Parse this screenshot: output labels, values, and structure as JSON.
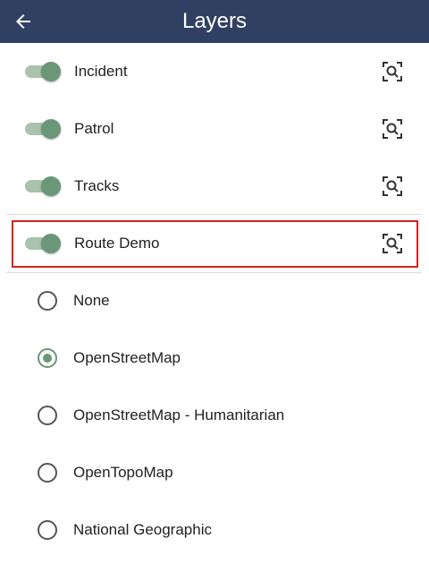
{
  "header": {
    "title": "Layers",
    "back_icon": "arrow-left-icon",
    "background": "#2f4063"
  },
  "layers": [
    {
      "label": "Incident",
      "enabled": true,
      "action_icon": "zoom-to-layer-icon"
    },
    {
      "label": "Patrol",
      "enabled": true,
      "action_icon": "zoom-to-layer-icon"
    },
    {
      "label": "Tracks",
      "enabled": true,
      "action_icon": "zoom-to-layer-icon"
    },
    {
      "label": "Route Demo",
      "enabled": true,
      "action_icon": "zoom-to-layer-icon",
      "highlighted": true
    }
  ],
  "basemaps": [
    {
      "label": "None",
      "selected": false
    },
    {
      "label": "OpenStreetMap",
      "selected": true
    },
    {
      "label": "OpenStreetMap - Humanitarian",
      "selected": false
    },
    {
      "label": "OpenTopoMap",
      "selected": false
    },
    {
      "label": "National Geographic",
      "selected": false
    }
  ],
  "colors": {
    "accent": "#6a9777",
    "toggle_track": "#a9c3ad",
    "highlight_border": "#d22222"
  }
}
